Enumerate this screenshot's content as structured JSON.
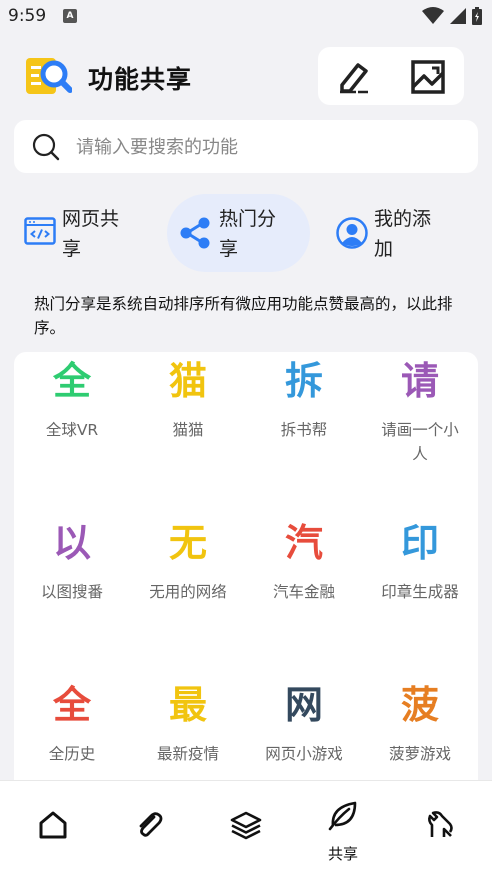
{
  "status_bar": {
    "time": "9:59",
    "notification_icon": "font-a-icon"
  },
  "header": {
    "title": "功能共享",
    "logo": "app-logo-magnifier",
    "actions": [
      "edit-icon",
      "image-icon"
    ]
  },
  "search": {
    "placeholder": "请输入要搜索的功能"
  },
  "tabs": [
    {
      "label_line1": "网页共",
      "label_line2": "享",
      "icon": "web-code-icon"
    },
    {
      "label_line1": "热门分",
      "label_line2": "享",
      "icon": "share-icon",
      "active": true
    },
    {
      "label_line1": "我的添",
      "label_line2": "加",
      "icon": "user-icon"
    }
  ],
  "description": "热门分享是系统自动排序所有微应用功能点赞最高的，以此排序。",
  "grid": [
    {
      "glyph": "全",
      "label": "全球VR",
      "color": "#2ecc71"
    },
    {
      "glyph": "猫",
      "label": "猫猫",
      "color": "#f1c40f"
    },
    {
      "glyph": "拆",
      "label": "拆书帮",
      "color": "#3498db"
    },
    {
      "glyph": "请",
      "label": "请画一个小人",
      "color": "#9b59b6"
    },
    {
      "glyph": "以",
      "label": "以图搜番",
      "color": "#9b59b6"
    },
    {
      "glyph": "无",
      "label": "无用的网络",
      "color": "#f1c40f"
    },
    {
      "glyph": "汽",
      "label": "汽车金融",
      "color": "#e74c3c"
    },
    {
      "glyph": "印",
      "label": "印章生成器",
      "color": "#3498db"
    },
    {
      "glyph": "全",
      "label": "全历史",
      "color": "#e74c3c"
    },
    {
      "glyph": "最",
      "label": "最新疫情",
      "color": "#f1c40f"
    },
    {
      "glyph": "网",
      "label": "网页小游戏",
      "color": "#34495e"
    },
    {
      "glyph": "菠",
      "label": "菠萝游戏",
      "color": "#e67e22"
    }
  ],
  "bottom_nav": [
    {
      "icon": "home-icon",
      "label": ""
    },
    {
      "icon": "paperclip-icon",
      "label": ""
    },
    {
      "icon": "layers-icon",
      "label": ""
    },
    {
      "icon": "leaf-icon",
      "label": "共享",
      "active": true
    },
    {
      "icon": "tools-icon",
      "label": ""
    }
  ]
}
